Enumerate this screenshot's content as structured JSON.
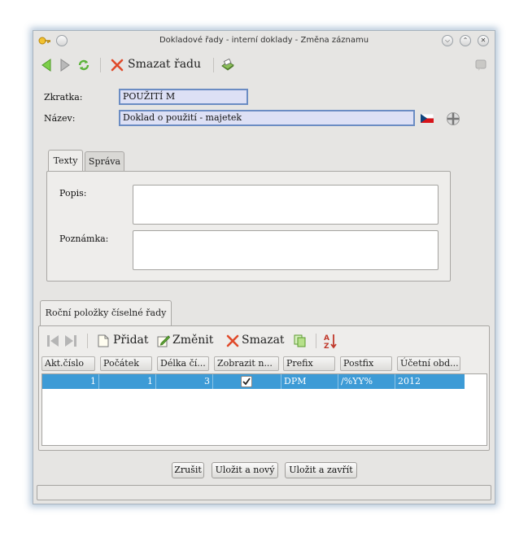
{
  "window": {
    "title": "Dokladové řady - interní doklady - Změna záznamu"
  },
  "toolbar": {
    "delete_series_label": "Smazat řadu"
  },
  "form": {
    "zkratka_label": "Zkratka:",
    "zkratka_value": "POUŽITÍ M",
    "nazev_label": "Název:",
    "nazev_value": "Doklad o použití - majetek"
  },
  "tabs": [
    {
      "label": "Texty"
    },
    {
      "label": "Správa"
    }
  ],
  "texty": {
    "popis_label": "Popis:",
    "poznamka_label": "Poznámka:"
  },
  "section": {
    "tab_label": "Roční položky číselné řady"
  },
  "subtoolbar": {
    "add_label": "Přidat",
    "edit_label": "Změnit",
    "delete_label": "Smazat"
  },
  "table": {
    "columns": [
      "Akt.číslo",
      "Počátek",
      "Délka čí...",
      "Zobrazit n...",
      "Prefix",
      "Postfix",
      "Účetní obd..."
    ],
    "rows": [
      {
        "akt": "1",
        "pocatek": "1",
        "delka": "3",
        "zobrazit": true,
        "prefix": "DPM",
        "postfix": "/%YY%",
        "obdobi": "2012"
      }
    ]
  },
  "buttons": {
    "cancel": "Zrušit",
    "save_new": "Uložit a nový",
    "save_close": "Uložit a zavřít"
  },
  "colors": {
    "selection": "#3d9bd6",
    "input_bg": "#dde0f5",
    "input_border": "#6b8cc3"
  }
}
